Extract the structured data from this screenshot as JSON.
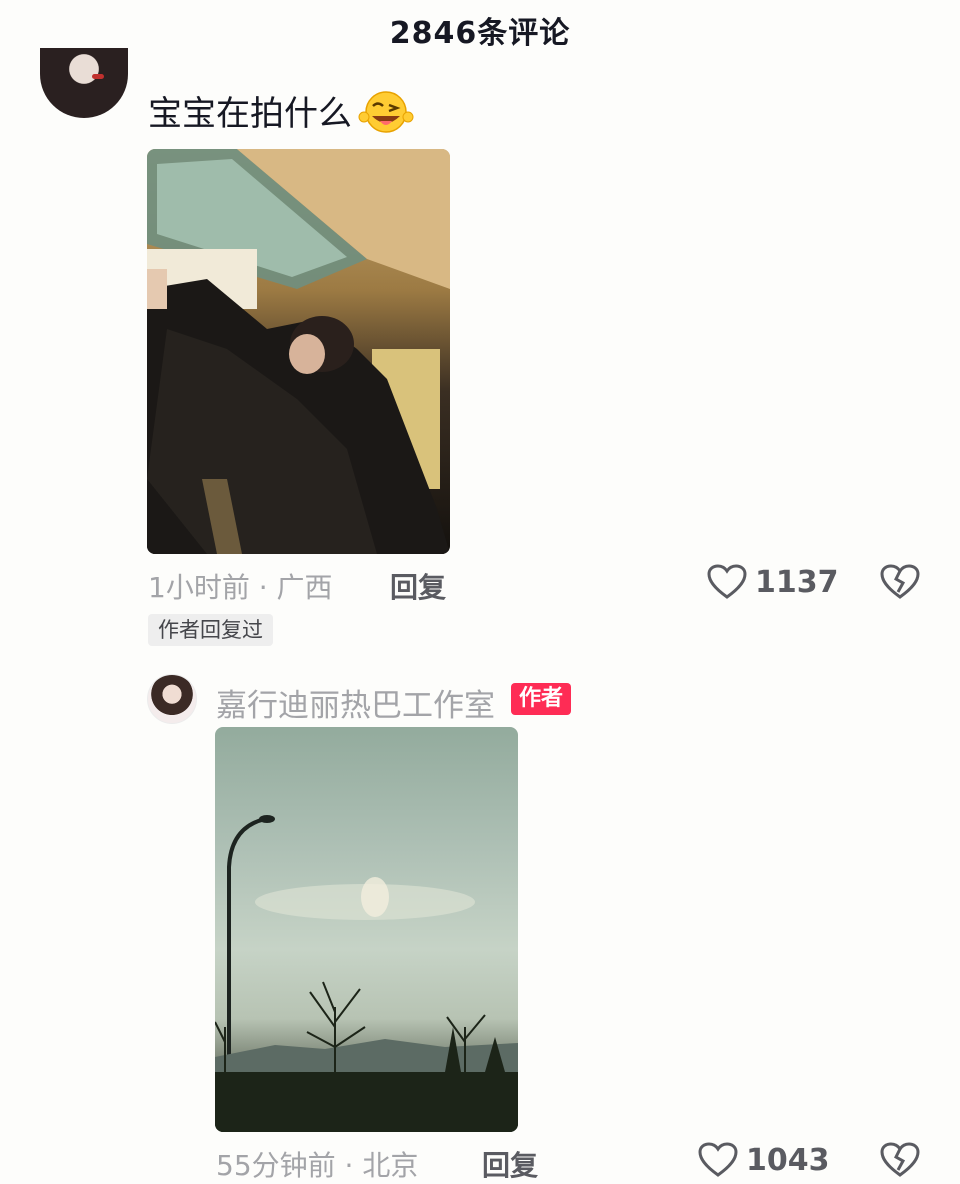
{
  "header": {
    "title": "2846条评论"
  },
  "comment": {
    "text": "宝宝在拍什么",
    "emoji_icon": "winking-tongue-emoji",
    "meta": "1小时前 · 广西",
    "reply_label": "回复",
    "like_count": "1137",
    "author_replied_badge": "作者回复过"
  },
  "reply": {
    "author_name": "嘉行迪丽热巴工作室",
    "author_badge": "作者",
    "meta": "55分钟前 · 北京",
    "reply_label": "回复",
    "like_count": "1043"
  },
  "colors": {
    "accent": "#fe2c55",
    "muted_text": "#a3a4a8",
    "strong_text": "#5a5b61"
  }
}
